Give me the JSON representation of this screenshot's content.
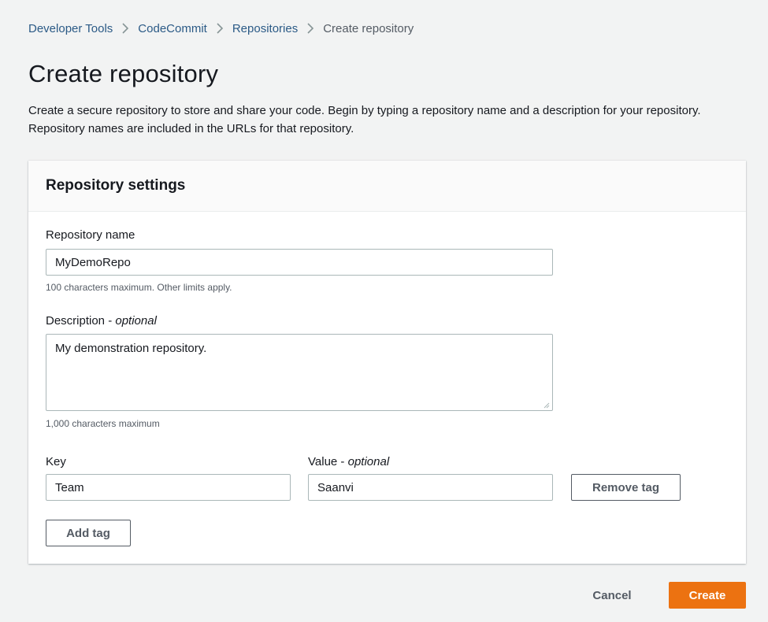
{
  "breadcrumb": {
    "items": [
      "Developer Tools",
      "CodeCommit",
      "Repositories"
    ],
    "current": "Create repository"
  },
  "page": {
    "title": "Create repository",
    "description": "Create a secure repository to store and share your code. Begin by typing a repository name and a description for your repository. Repository names are included in the URLs for that repository."
  },
  "settings": {
    "title": "Repository settings",
    "name_label": "Repository name",
    "name_value": "MyDemoRepo",
    "name_hint": "100 characters maximum. Other limits apply.",
    "desc_label": "Description",
    "desc_optional": "optional",
    "desc_value": "My demonstration repository.",
    "desc_hint": "1,000 characters maximum",
    "key_label": "Key",
    "value_label": "Value",
    "value_optional": "optional",
    "tag_key": "Team",
    "tag_value": "Saanvi",
    "remove_tag_label": "Remove tag",
    "add_tag_label": "Add tag"
  },
  "footer": {
    "cancel_label": "Cancel",
    "create_label": "Create"
  },
  "colors": {
    "accent": "#ec7211",
    "link": "#2b5a86"
  }
}
